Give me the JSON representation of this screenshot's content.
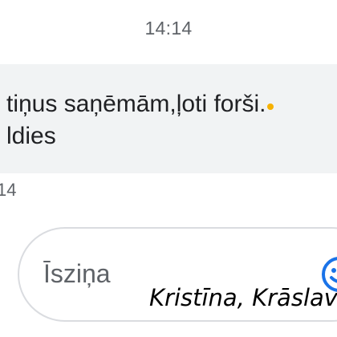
{
  "header": {
    "time": "14:14"
  },
  "message": {
    "line1": "tiņus saņēmām,ļoti forši.",
    "line2": "ldies",
    "time": "14",
    "bubble_color": "#f1f3f4"
  },
  "compose": {
    "placeholder": "Īsziņa",
    "emoji_icon": "smiley-icon",
    "accent": "#1a73e8"
  },
  "caption": {
    "text": "Kristīna, Krāslav"
  }
}
